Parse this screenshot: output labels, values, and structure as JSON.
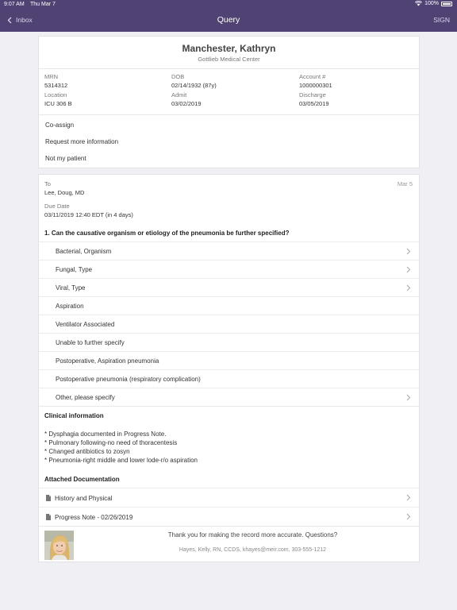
{
  "status_bar": {
    "time": "9:07 AM",
    "date": "Thu Mar 7",
    "battery": "100%"
  },
  "nav": {
    "back_label": "Inbox",
    "title": "Query",
    "action_label": "SIGN"
  },
  "patient": {
    "name": "Manchester, Kathryn",
    "facility": "Gottlieb Medical Center",
    "fields": [
      {
        "label": "MRN",
        "value": "5314312"
      },
      {
        "label": "DOB",
        "value": "02/14/1932 (87y)"
      },
      {
        "label": "Account #",
        "value": "1000000301"
      },
      {
        "label": "Location",
        "value": "ICU 306 B"
      },
      {
        "label": "Admit",
        "value": "03/02/2019"
      },
      {
        "label": "Discharge",
        "value": "03/05/2019"
      }
    ],
    "actions": [
      "Co-assign",
      "Request more information",
      "Not my patient"
    ]
  },
  "query": {
    "to_label": "To",
    "to_value": "Lee, Doug, MD",
    "date": "Mar 5",
    "due_label": "Due Date",
    "due_value": "03/11/2019 12:40 EDT (in 4 days)",
    "question": "1. Can the causative organism or etiology of the pneumonia be further specified?",
    "options": [
      {
        "label": "Bacterial, Organism"
      },
      {
        "label": "Fungal, Type"
      },
      {
        "label": "Viral, Type"
      },
      {
        "label": "Aspiration"
      },
      {
        "label": "Ventilator Associated"
      },
      {
        "label": "Unable to further specify"
      },
      {
        "label": "Postoperative, Aspiration pneumonia"
      },
      {
        "label": "Postoperative pneumonia (respiratory complication)"
      },
      {
        "label": "Other, please specify"
      }
    ],
    "clinical_title": "Clinical information",
    "clinical_lines": [
      "* Dysphagia documented in Progress Note.",
      "* Pulmonary following-no need of thoracentesis",
      "* Changed antibiotics to zosyn",
      "* Pneumonia-right middle and lower lode-r/o aspiration"
    ],
    "attached_title": "Attached Documentation",
    "documents": [
      {
        "label": "History and Physical"
      },
      {
        "label": "Progress Note - 02/26/2019"
      }
    ],
    "thanks": "Thank you for making the record more accurate. Questions?",
    "contact": "Hayes, Kelly, RN, CCDS,  khayes@meir.com,  303-555-1212"
  },
  "colors": {
    "nav_background": "#504374",
    "divider": "#ececf0"
  }
}
